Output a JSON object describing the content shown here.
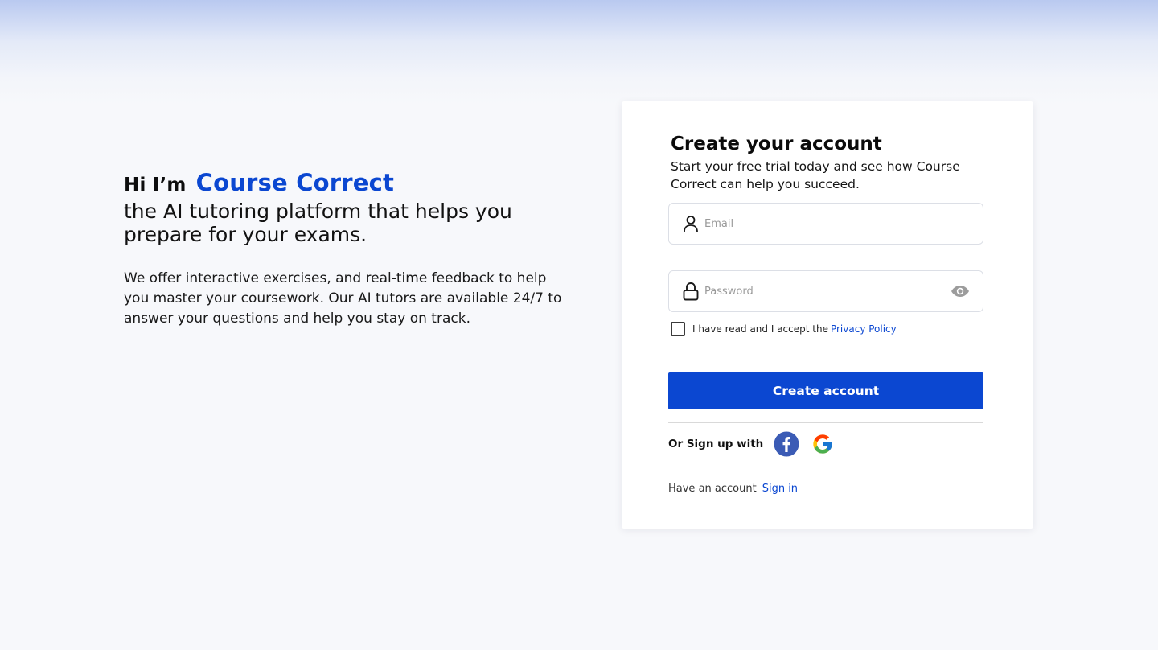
{
  "hero": {
    "greeting": "Hi I’m",
    "brand": "Course Correct",
    "tagline": "the AI tutoring platform that helps you prepare for your exams.",
    "description": "We offer interactive exercises, and real-time feedback to help you master your coursework. Our AI tutors are available 24/7 to answer your questions and help you stay on track."
  },
  "form": {
    "title": "Create your account",
    "subtitle": "Start your free trial today and see how Course Correct can help you succeed.",
    "email": {
      "placeholder": "Email",
      "value": "",
      "icon": "user-icon"
    },
    "password": {
      "placeholder": "Password",
      "value": "",
      "icon": "lock-icon",
      "toggle_icon": "eye-icon"
    },
    "consent": {
      "text": "I have read  and I accept the",
      "link": "Privacy Policy",
      "checked": false
    },
    "submit_label": "Create account",
    "social_label": "Or Sign up with",
    "social": [
      "facebook-icon",
      "google-icon"
    ],
    "signin_prompt": "Have an account",
    "signin_link": "Sign in"
  },
  "colors": {
    "accent": "#0b47d1",
    "background": "#f7f8fb",
    "card": "#ffffff",
    "facebook": "#3b5bb5"
  }
}
